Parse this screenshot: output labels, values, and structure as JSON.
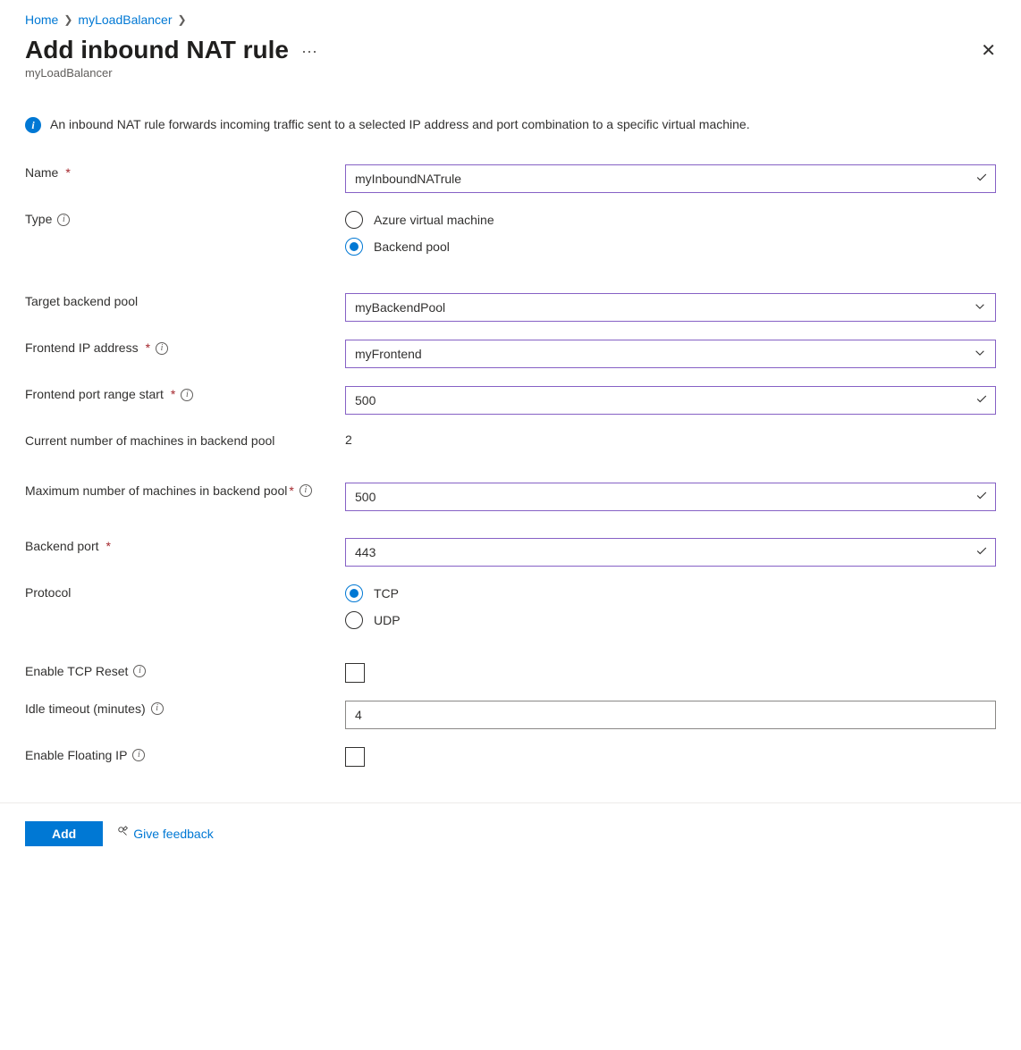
{
  "breadcrumb": {
    "home": "Home",
    "resource": "myLoadBalancer"
  },
  "header": {
    "title": "Add inbound NAT rule",
    "subtitle": "myLoadBalancer"
  },
  "info": {
    "text": "An inbound NAT rule forwards incoming traffic sent to a selected IP address and port combination to a specific virtual machine."
  },
  "form": {
    "name": {
      "label": "Name",
      "value": "myInboundNATrule"
    },
    "type": {
      "label": "Type",
      "options": {
        "vm": "Azure virtual machine",
        "pool": "Backend pool"
      },
      "selected": "pool"
    },
    "target_backend_pool": {
      "label": "Target backend pool",
      "value": "myBackendPool"
    },
    "frontend_ip": {
      "label": "Frontend IP address",
      "value": "myFrontend"
    },
    "frontend_port_start": {
      "label": "Frontend port range start",
      "value": "500"
    },
    "current_machines": {
      "label": "Current number of machines in backend pool",
      "value": "2"
    },
    "max_machines": {
      "label": "Maximum number of machines in backend pool",
      "value": "500"
    },
    "backend_port": {
      "label": "Backend port",
      "value": "443"
    },
    "protocol": {
      "label": "Protocol",
      "options": {
        "tcp": "TCP",
        "udp": "UDP"
      },
      "selected": "tcp"
    },
    "tcp_reset": {
      "label": "Enable TCP Reset",
      "checked": false
    },
    "idle_timeout": {
      "label": "Idle timeout (minutes)",
      "value": "4"
    },
    "floating_ip": {
      "label": "Enable Floating IP",
      "checked": false
    }
  },
  "footer": {
    "add": "Add",
    "feedback": "Give feedback"
  }
}
